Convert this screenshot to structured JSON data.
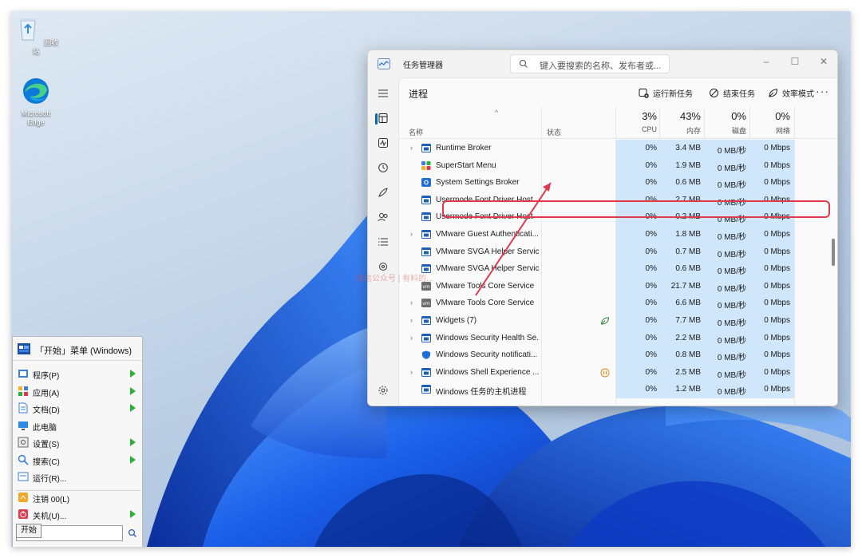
{
  "desktop": {
    "icons": [
      {
        "name": "recycle-bin",
        "label": "回收站"
      },
      {
        "name": "edge",
        "label": "Microsoft Edge"
      }
    ]
  },
  "task_manager": {
    "title": "任务管理器",
    "search_placeholder": "键入要搜索的名称、发布者或...",
    "window_buttons": {
      "minimize": "–",
      "maximize": "☐",
      "close": "✕"
    },
    "page_title": "进程",
    "toolbar": {
      "run_new_task": "运行新任务",
      "end_task": "结束任务",
      "efficiency_mode": "效率模式",
      "more": "···"
    },
    "columns": {
      "sort_glyph": "^",
      "name": "名称",
      "status": "状态",
      "cpu": {
        "pct": "3%",
        "label": "CPU"
      },
      "memory": {
        "pct": "43%",
        "label": "内存"
      },
      "disk": {
        "pct": "0%",
        "label": "磁盘"
      },
      "network": {
        "pct": "0%",
        "label": "网络"
      }
    },
    "processes": [
      {
        "expandable": true,
        "name": "Runtime Broker",
        "icon": "window-icon",
        "status": "",
        "cpu": "0%",
        "memory": "3.4 MB",
        "disk": "0 MB/秒",
        "network": "0 Mbps"
      },
      {
        "expandable": false,
        "name": "SuperStart Menu",
        "icon": "superstart-icon",
        "status": "",
        "cpu": "0%",
        "memory": "1.9 MB",
        "disk": "0 MB/秒",
        "network": "0 Mbps"
      },
      {
        "expandable": false,
        "name": "System Settings Broker",
        "icon": "gear-blue-icon",
        "status": "",
        "cpu": "0%",
        "memory": "0.6 MB",
        "disk": "0 MB/秒",
        "network": "0 Mbps"
      },
      {
        "expandable": false,
        "name": "Usermode Font Driver Host",
        "icon": "window-icon",
        "status": "",
        "cpu": "0%",
        "memory": "2.7 MB",
        "disk": "0 MB/秒",
        "network": "0 Mbps"
      },
      {
        "expandable": false,
        "name": "Usermode Font Driver Host",
        "icon": "window-icon",
        "status": "",
        "cpu": "0%",
        "memory": "0.2 MB",
        "disk": "0 MB/秒",
        "network": "0 Mbps"
      },
      {
        "expandable": true,
        "name": "VMware Guest Authenticati...",
        "icon": "window-icon",
        "status": "",
        "cpu": "0%",
        "memory": "1.8 MB",
        "disk": "0 MB/秒",
        "network": "0 Mbps"
      },
      {
        "expandable": false,
        "name": "VMware SVGA Helper Service",
        "icon": "window-icon",
        "status": "",
        "cpu": "0%",
        "memory": "0.7 MB",
        "disk": "0 MB/秒",
        "network": "0 Mbps"
      },
      {
        "expandable": false,
        "name": "VMware SVGA Helper Service",
        "icon": "window-icon",
        "status": "",
        "cpu": "0%",
        "memory": "0.6 MB",
        "disk": "0 MB/秒",
        "network": "0 Mbps"
      },
      {
        "expandable": false,
        "name": "VMware Tools Core Service",
        "icon": "vm-icon",
        "status": "",
        "cpu": "0%",
        "memory": "21.7 MB",
        "disk": "0 MB/秒",
        "network": "0 Mbps"
      },
      {
        "expandable": true,
        "name": "VMware Tools Core Service",
        "icon": "vm-icon",
        "status": "",
        "cpu": "0%",
        "memory": "6.6 MB",
        "disk": "0 MB/秒",
        "network": "0 Mbps"
      },
      {
        "expandable": true,
        "name": "Widgets (7)",
        "icon": "window-icon",
        "status": "efficiency-leaf-icon",
        "cpu": "0%",
        "memory": "7.7 MB",
        "disk": "0 MB/秒",
        "network": "0 Mbps"
      },
      {
        "expandable": true,
        "name": "Windows Security Health Se...",
        "icon": "window-icon",
        "status": "",
        "cpu": "0%",
        "memory": "2.2 MB",
        "disk": "0 MB/秒",
        "network": "0 Mbps"
      },
      {
        "expandable": false,
        "name": "Windows Security notificati...",
        "icon": "shield-icon",
        "status": "",
        "cpu": "0%",
        "memory": "0.8 MB",
        "disk": "0 MB/秒",
        "network": "0 Mbps"
      },
      {
        "expandable": true,
        "name": "Windows Shell Experience ...",
        "icon": "window-icon",
        "status": "paused-icon",
        "cpu": "0%",
        "memory": "2.5 MB",
        "disk": "0 MB/秒",
        "network": "0 Mbps"
      },
      {
        "expandable": false,
        "name": "Windows 任务的主机进程",
        "icon": "window-icon",
        "status": "",
        "cpu": "0%",
        "memory": "1.2 MB",
        "disk": "0 MB/秒",
        "network": "0 Mbps"
      }
    ],
    "highlighted_process": "SuperStart Menu",
    "watermark": "微信公众号 | 有料的..."
  },
  "start_menu": {
    "header": "「开始」菜单 (Windows)",
    "items": [
      {
        "label": "程序(P)",
        "submenu": true
      },
      {
        "label": "应用(A)",
        "submenu": true
      },
      {
        "label": "文档(D)",
        "submenu": true
      },
      {
        "label": "此电脑",
        "submenu": false
      },
      {
        "label": "设置(S)",
        "submenu": true
      },
      {
        "label": "搜索(C)",
        "submenu": true
      },
      {
        "label": "运行(R)...",
        "submenu": false
      },
      {
        "label": "注销 00(L)",
        "submenu": false
      },
      {
        "label": "关机(U)...",
        "submenu": true
      }
    ],
    "tooltip": "开始"
  },
  "colors": {
    "accent": "#0067c0",
    "highlight_red": "#e2394a",
    "metric_fill": "#cfe6fb",
    "submenu_arrow": "#2fae3a"
  }
}
